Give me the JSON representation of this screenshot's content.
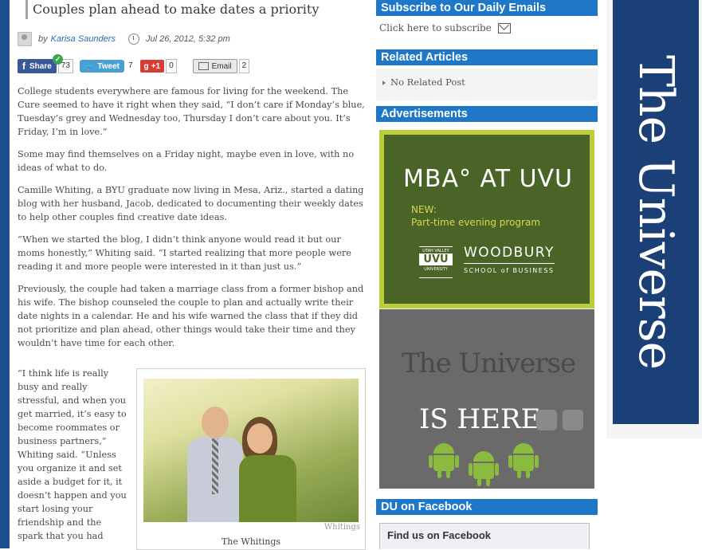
{
  "article": {
    "title": "Couples plan ahead to make dates a priority",
    "byline_prefix": "by",
    "author": "Karisa Saunders",
    "date": "Jul 26, 2012, 5:32 pm",
    "paragraphs": [
      "College students everywhere are famous for living for the weekend. The Cure seemed to have it right when they said, “I don’t care if Monday’s blue, Tuesday’s grey and Wednesday too, Thursday I don’t care about you. It’s Friday, I’m in love.”",
      "Some may find themselves on a Friday night, maybe even in love, with no ideas of what to do.",
      "Camille Whiting, a BYU graduate now living in Mesa, Ariz., started a dating blog with her husband, Jacob, dedicated to documenting their weekly dates to help other couples find creative date ideas.",
      "“When we started the blog, I didn’t think anyone would read it but our moms honestly,” Whiting said. “I started realizing that more people were reading it and more people were interested in it than just us.”",
      "Previously, the couple had taken a marriage class from a former bishop and his wife. The bishop counseled the couple to plan and actually write their date nights in a calendar. He and his wife warned the class that if they did not prioritize and plan ahead, other things would take their time and they wouldn’t have time for each other."
    ],
    "side_paragraph": "“I think life is really busy and really stressful, and when you get married, it’s easy to become roommates or business partners,” Whiting said. “Unless you organize it and set aside a budget for it, it doesn’t happen and you start losing your friendship and the spark that you had",
    "photo_watermark": "Whitings",
    "photo_caption": "The Whitings"
  },
  "share": {
    "facebook_label": "Share",
    "facebook_count": "73",
    "tweet_label": "Tweet",
    "tweet_count": "7",
    "gplus_label": "+1",
    "gplus_count": "0",
    "email_label": "Email",
    "email_count": "2"
  },
  "sidebar": {
    "subscribe_heading": "Subscribe to Our Daily Emails",
    "subscribe_link": "Click here to subscribe",
    "related_heading": "Related Articles",
    "related_item": "No Related Post",
    "ads_heading": "Advertisements",
    "mba_ad": {
      "title": "MBA° AT UVU",
      "new_label": "NEW:",
      "new_text": "Part-time evening program",
      "uvu_small": "UTAH VALLEY",
      "uvu_big": "UVU",
      "uvu_small2": "UNIVERSITY",
      "school_name": "WOODBURY",
      "school_line": "SCHOOL of BUSINESS"
    },
    "universe_ad": {
      "logo": "The Universe",
      "tagline": "IS  HERE"
    },
    "facebook_heading": "DU on Facebook",
    "facebook_box": "Find us on Facebook"
  },
  "banner": {
    "text": "The Universe"
  },
  "colors": {
    "widget_blue": "#1f77c7",
    "banner_navy": "#1b3f77",
    "mba_green": "#4a6428",
    "android_green": "#8bbb3e"
  }
}
